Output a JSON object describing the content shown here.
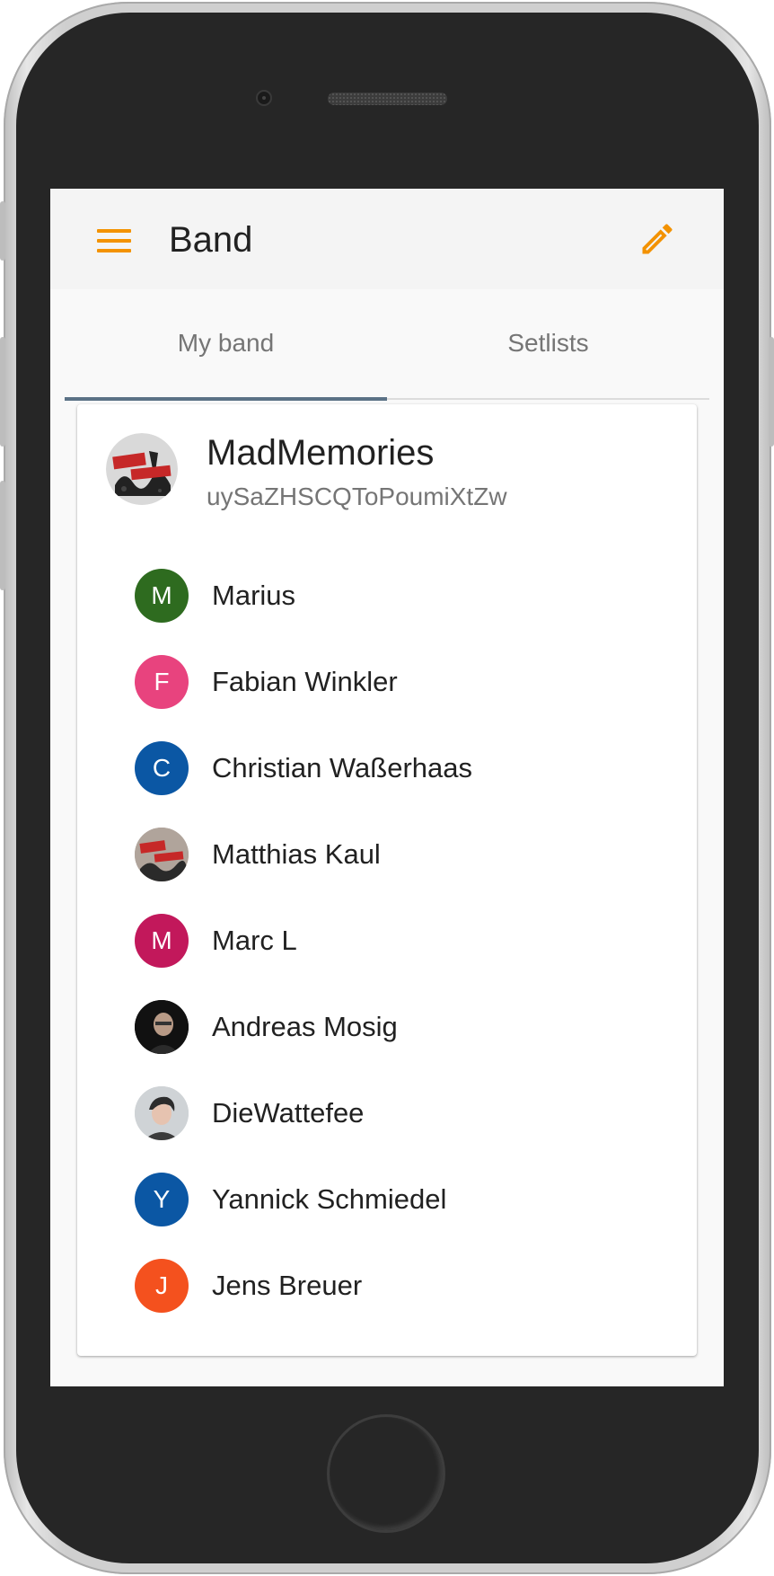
{
  "app_bar": {
    "title": "Band",
    "menu_icon": "menu-icon",
    "edit_icon": "pencil-icon",
    "accent_color": "#f39200"
  },
  "tabs": [
    {
      "label": "My band",
      "active": true
    },
    {
      "label": "Setlists",
      "active": false
    }
  ],
  "band": {
    "name": "MadMemories",
    "id": "uySaZHSCQToPoumiXtZw"
  },
  "members": [
    {
      "name": "Marius",
      "initial": "M",
      "color": "#2e6b1f",
      "avatar": "letter"
    },
    {
      "name": "Fabian Winkler",
      "initial": "F",
      "color": "#e8437e",
      "avatar": "letter"
    },
    {
      "name": "Christian Waßerhaas",
      "initial": "C",
      "color": "#0b57a4",
      "avatar": "letter"
    },
    {
      "name": "Matthias Kaul",
      "initial": "",
      "color": "#b0a49b",
      "avatar": "band-logo-photo"
    },
    {
      "name": "Marc L",
      "initial": "M",
      "color": "#c2185b",
      "avatar": "letter"
    },
    {
      "name": "Andreas Mosig",
      "initial": "",
      "color": "#111111",
      "avatar": "portrait-photo"
    },
    {
      "name": "DieWattefee",
      "initial": "",
      "color": "#cfd3d6",
      "avatar": "portrait-photo"
    },
    {
      "name": "Yannick Schmiedel",
      "initial": "Y",
      "color": "#0b57a4",
      "avatar": "letter"
    },
    {
      "name": "Jens Breuer",
      "initial": "J",
      "color": "#f4511e",
      "avatar": "letter"
    }
  ],
  "colors": {
    "tab_indicator": "#5b7286",
    "text_primary": "#212121",
    "text_secondary": "#757575"
  }
}
